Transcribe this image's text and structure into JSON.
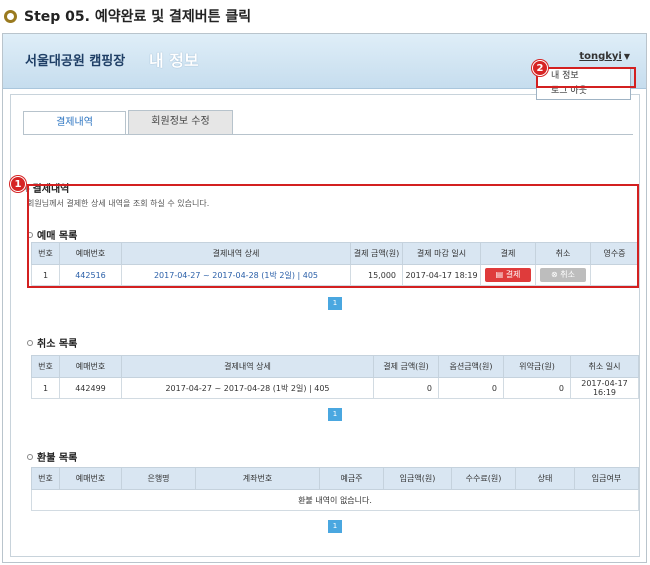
{
  "step_title": "Step 05. 예약완료 및 결제버튼 클릭",
  "header": {
    "site_name": "서울대공원 캠핑장",
    "page_name": "내 정보",
    "user": "tongkyi",
    "dropdown": [
      "내 정보",
      "로그 아웃"
    ]
  },
  "badges": [
    "1",
    "2"
  ],
  "tabs": [
    "결제내역",
    "회원정보 수정"
  ],
  "payment": {
    "title": "결제내역",
    "desc": "회원님께서 결제한 상세 내역을 조회 하실 수 있습니다."
  },
  "reservation": {
    "title": "예매 목록",
    "columns": [
      "번호",
      "예매번호",
      "결제내역 상세",
      "결제 금액(원)",
      "결제 마감 일시",
      "결제",
      "취소",
      "영수증"
    ],
    "rows": [
      {
        "no": "1",
        "id": "442516",
        "detail": "2017-04-27 ~ 2017-04-28 (1박 2일) | 405",
        "amount": "15,000",
        "deadline": "2017-04-17 18:19",
        "pay_btn": "결제",
        "cancel_btn": "취소",
        "receipt": ""
      }
    ],
    "page": "1"
  },
  "cancellation": {
    "title": "취소 목록",
    "columns": [
      "번호",
      "예매번호",
      "결제내역 상세",
      "결제 금액(원)",
      "옵션금액(원)",
      "위약금(원)",
      "취소 일시"
    ],
    "rows": [
      {
        "no": "1",
        "id": "442499",
        "detail": "2017-04-27 ~ 2017-04-28 (1박 2일) | 405",
        "amount": "0",
        "option": "0",
        "penalty": "0",
        "date": "2017-04-17 16:19"
      }
    ],
    "page": "1"
  },
  "refund": {
    "title": "환불 목록",
    "columns": [
      "번호",
      "예매번호",
      "은행명",
      "계좌번호",
      "예금주",
      "입금액(원)",
      "수수료(원)",
      "상태",
      "입금여부"
    ],
    "empty": "환불 내역이 없습니다.",
    "page": "1"
  }
}
